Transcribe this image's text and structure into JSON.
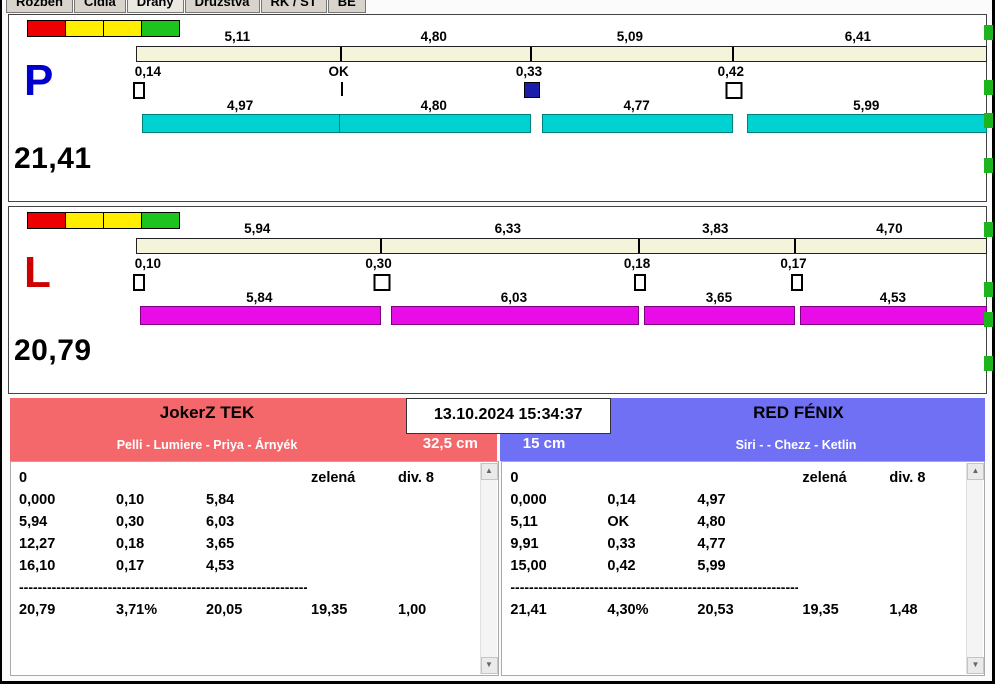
{
  "tabs": [
    "Rozbeh",
    "Čidla",
    "Dráhy",
    "Družstvá",
    "RK / ST",
    "BE"
  ],
  "active_tab": "Dráhy",
  "icons": {
    "scroll_up": "▲",
    "scroll_down": "▼"
  },
  "lanes": [
    {
      "letter": "P",
      "letter_color": "#0000cc",
      "total_label": "21,41",
      "total_value": 21.41,
      "run_bar_color": "#00d2d2",
      "run_bar_border": "#007d7d",
      "split_track_color": "#f4f4da",
      "status_lights": [
        "#ee0000",
        "#ffee00",
        "#ffee00",
        "#1ec41e"
      ],
      "splits": [
        {
          "label": "5,11",
          "value": 5.11
        },
        {
          "label": "4,80",
          "value": 4.8
        },
        {
          "label": "5,09",
          "value": 5.09
        },
        {
          "label": "6,41",
          "value": 6.41
        }
      ],
      "crossings": [
        {
          "label": "0,14",
          "value": 0.14,
          "marker": "bar"
        },
        {
          "label": "OK",
          "value": 0,
          "marker": "tick"
        },
        {
          "label": "0,33",
          "value": 0.33,
          "marker": "filled"
        },
        {
          "label": "0,42",
          "value": 0.42,
          "marker": "open"
        }
      ],
      "clean_times": [
        {
          "label": "4,97",
          "value": 4.97
        },
        {
          "label": "4,80",
          "value": 4.8
        },
        {
          "label": "4,77",
          "value": 4.77
        },
        {
          "label": "5,99",
          "value": 5.99
        }
      ]
    },
    {
      "letter": "L",
      "letter_color": "#cc0000",
      "total_label": "20,79",
      "total_value": 20.79,
      "run_bar_color": "#e80ce8",
      "run_bar_border": "#7d007d",
      "split_track_color": "#f4f4da",
      "status_lights": [
        "#ee0000",
        "#ffee00",
        "#ffee00",
        "#1ec41e"
      ],
      "splits": [
        {
          "label": "5,94",
          "value": 5.94
        },
        {
          "label": "6,33",
          "value": 6.33
        },
        {
          "label": "3,83",
          "value": 3.83
        },
        {
          "label": "4,70",
          "value": 4.7
        }
      ],
      "crossings": [
        {
          "label": "0,10",
          "value": 0.1,
          "marker": "bar"
        },
        {
          "label": "0,30",
          "value": 0.3,
          "marker": "open"
        },
        {
          "label": "0,18",
          "value": 0.18,
          "marker": "bar"
        },
        {
          "label": "0,17",
          "value": 0.17,
          "marker": "bar"
        }
      ],
      "clean_times": [
        {
          "label": "5,84",
          "value": 5.84
        },
        {
          "label": "6,03",
          "value": 6.03
        },
        {
          "label": "3,65",
          "value": 3.65
        },
        {
          "label": "4,53",
          "value": 4.53
        }
      ]
    }
  ],
  "scoreboard": {
    "datetime": "13.10.2024 15:34:37",
    "left_team": {
      "name": "JokerZ TEK",
      "dogs": "Pelli - Lumiere - Priya - Árnyék",
      "jump_height": "32,5 cm",
      "color": "#f4686c"
    },
    "right_team": {
      "name": "RED FÉNIX",
      "dogs": "Siri -  - Chezz - Ketlin",
      "jump_height": "15 cm",
      "color": "#6f70f4"
    },
    "separator": "--------------------------------------------------------------------------------",
    "left_table": {
      "rows": [
        [
          "0",
          "",
          "",
          "zelená",
          "div. 8"
        ],
        [
          "0,000",
          "0,10",
          "5,84",
          "",
          ""
        ],
        [
          "5,94",
          "0,30",
          "6,03",
          "",
          ""
        ],
        [
          "12,27",
          "0,18",
          "3,65",
          "",
          ""
        ],
        [
          "16,10",
          "0,17",
          "4,53",
          "",
          ""
        ]
      ],
      "summary": [
        "20,79",
        "3,71%",
        "20,05",
        "19,35",
        "1,00"
      ]
    },
    "right_table": {
      "rows": [
        [
          "0",
          "",
          "",
          "zelená",
          "div. 8"
        ],
        [
          "0,000",
          "0,14",
          "4,97",
          "",
          ""
        ],
        [
          "5,11",
          "OK",
          "4,80",
          "",
          ""
        ],
        [
          "9,91",
          "0,33",
          "4,77",
          "",
          ""
        ],
        [
          "15,00",
          "0,42",
          "5,99",
          "",
          ""
        ]
      ],
      "summary": [
        "21,41",
        "4,30%",
        "20,53",
        "19,35",
        "1,48"
      ]
    }
  }
}
